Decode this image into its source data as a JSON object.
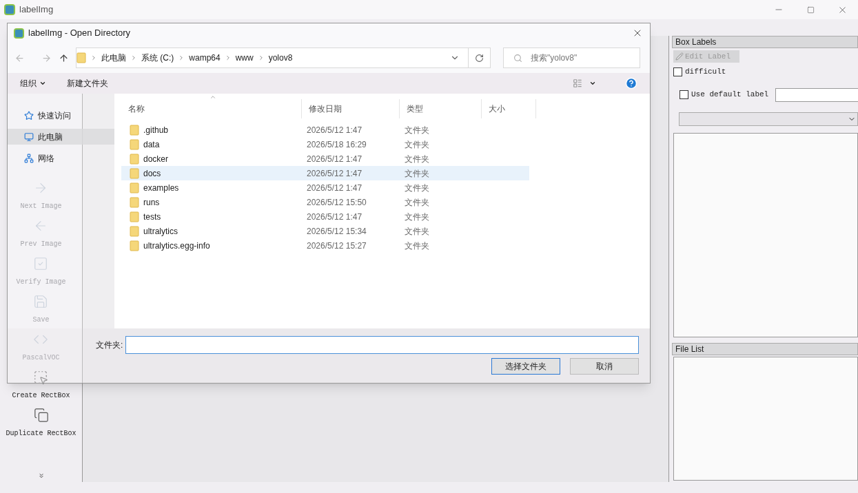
{
  "window": {
    "title": "labelImg"
  },
  "toolbar": {
    "items": [
      {
        "label": "Next Image",
        "disabled": true
      },
      {
        "label": "Prev Image",
        "disabled": true
      },
      {
        "label": "Verify Image",
        "disabled": true
      },
      {
        "label": "Save",
        "disabled": true
      },
      {
        "label": "PascalVOC",
        "disabled": true
      },
      {
        "label": "Create RectBox",
        "disabled": false
      },
      {
        "label": "Duplicate RectBox",
        "disabled": false
      }
    ]
  },
  "box_labels": {
    "title": "Box Labels",
    "edit_button": {
      "label": "Edit Label",
      "disabled": true
    },
    "difficult": {
      "label": "difficult",
      "checked": false
    },
    "use_default": {
      "label": "Use default label",
      "checked": false
    }
  },
  "file_list": {
    "title": "File List"
  },
  "dialog": {
    "title": "labelImg - Open Directory",
    "breadcrumbs": [
      "此电脑",
      "系统 (C:)",
      "wamp64",
      "www",
      "yolov8"
    ],
    "search": {
      "placeholder": "搜索\"yolov8\""
    },
    "commands": [
      {
        "label": "组织",
        "dropdown": true
      },
      {
        "label": "新建文件夹",
        "dropdown": false
      }
    ],
    "nav": [
      {
        "label": "快速访问",
        "selected": false
      },
      {
        "label": "此电脑",
        "selected": true
      },
      {
        "label": "网络",
        "selected": false
      }
    ],
    "columns": [
      "名称",
      "修改日期",
      "类型",
      "大小"
    ],
    "rows": [
      {
        "name": ".github",
        "date": "2026/5/12 1:47",
        "type": "文件夹",
        "highlighted": false
      },
      {
        "name": "data",
        "date": "2026/5/18 16:29",
        "type": "文件夹",
        "highlighted": false
      },
      {
        "name": "docker",
        "date": "2026/5/12 1:47",
        "type": "文件夹",
        "highlighted": false
      },
      {
        "name": "docs",
        "date": "2026/5/12 1:47",
        "type": "文件夹",
        "highlighted": true
      },
      {
        "name": "examples",
        "date": "2026/5/12 1:47",
        "type": "文件夹",
        "highlighted": false
      },
      {
        "name": "runs",
        "date": "2026/5/12 15:50",
        "type": "文件夹",
        "highlighted": false
      },
      {
        "name": "tests",
        "date": "2026/5/12 1:47",
        "type": "文件夹",
        "highlighted": false
      },
      {
        "name": "ultralytics",
        "date": "2026/5/12 15:34",
        "type": "文件夹",
        "highlighted": false
      },
      {
        "name": "ultralytics.egg-info",
        "date": "2026/5/12 15:27",
        "type": "文件夹",
        "highlighted": false
      }
    ],
    "folder_label": "文件夹:",
    "buttons": [
      {
        "label": "选择文件夹",
        "kind": "primary"
      },
      {
        "label": "取消",
        "kind": "normal"
      }
    ]
  }
}
